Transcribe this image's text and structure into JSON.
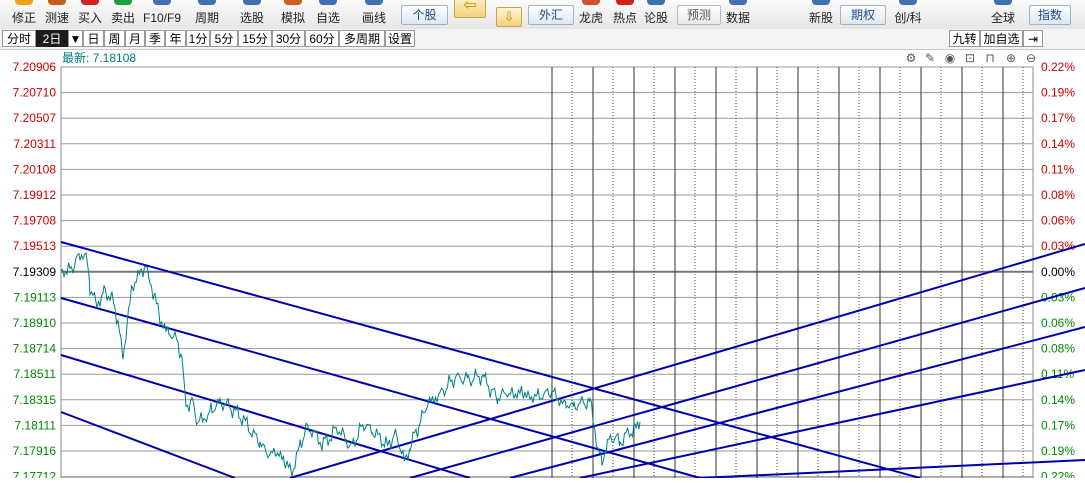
{
  "toolbar": {
    "items": [
      {
        "label": "修正",
        "icon": "edit-icon",
        "color": "#f0a020"
      },
      {
        "label": "测速",
        "icon": "speed-icon",
        "color": "#c06020"
      },
      {
        "label": "买入",
        "icon": "buy-icon",
        "color": "#d02020"
      },
      {
        "label": "卖出",
        "icon": "sell-icon",
        "color": "#20a040"
      },
      {
        "label": "F10/F9",
        "icon": "f10-icon",
        "color": "#4070b0"
      },
      {
        "label": "周期",
        "icon": "period-icon",
        "color": "#4070b0"
      },
      {
        "label": "选股",
        "icon": "stock-picker-icon",
        "color": "#4070b0"
      },
      {
        "label": "模拟",
        "icon": "simulate-icon",
        "color": "#d06020"
      },
      {
        "label": "自选",
        "icon": "watchlist-icon",
        "color": "#4070b0"
      },
      {
        "label": "画线",
        "icon": "draw-line-icon",
        "color": "#4070b0"
      },
      {
        "label": "龙虎",
        "icon": "dragon-tiger-icon",
        "color": "#d05030"
      },
      {
        "label": "热点",
        "icon": "hot-icon",
        "color": "#d02020"
      },
      {
        "label": "论股",
        "icon": "forum-icon",
        "color": "#4070b0"
      },
      {
        "label": "数据",
        "icon": "data-icon",
        "color": "#4070b0"
      },
      {
        "label": "新股",
        "icon": "new-stock-icon",
        "color": "#4070b0"
      },
      {
        "label": "创/科",
        "icon": "star-market-icon",
        "color": "#4070b0"
      },
      {
        "label": "全球",
        "icon": "globe-icon",
        "color": "#4070b0"
      }
    ],
    "btn_gegu": "个股",
    "btn_waihui": "外汇",
    "btn_yuce": "预测",
    "btn_qiquan": "期权",
    "btn_zhishu": "指数",
    "arrow_left": "⇦",
    "arrow_down": "⇩"
  },
  "tabs": {
    "items": [
      "分时",
      "2日",
      "▼",
      "日",
      "周",
      "月",
      "季",
      "年",
      "1分",
      "5分",
      "15分",
      "30分",
      "60分",
      "多周期",
      "设置"
    ],
    "active_index": 1,
    "right": [
      "九转",
      "加自选",
      "⇥"
    ]
  },
  "chart": {
    "latest_label": "最新: 7.18108",
    "y_labels_left": [
      "7.20906",
      "7.20710",
      "7.20507",
      "7.20311",
      "7.20108",
      "7.19912",
      "7.19708",
      "7.19513",
      "7.19309",
      "7.19113",
      "7.18910",
      "7.18714",
      "7.18511",
      "7.18315",
      "7.18111",
      "7.17916",
      "7.17712"
    ],
    "y_labels_right": [
      "0.22%",
      "0.19%",
      "0.17%",
      "0.14%",
      "0.11%",
      "0.08%",
      "0.06%",
      "0.03%",
      "0.00%",
      "0.03%",
      "0.06%",
      "0.08%",
      "0.11%",
      "0.14%",
      "0.17%",
      "0.19%",
      "0.22%"
    ],
    "base_index": 8,
    "colors": {
      "up": "#d00000",
      "down": "#008800",
      "neutral": "#000000",
      "price": "#008080",
      "channel": "#0000aa"
    },
    "tool_icons": [
      "gear-icon",
      "pencil-icon",
      "eye-icon",
      "lock-icon",
      "lock-open-icon",
      "zoom-in-icon",
      "zoom-out-icon"
    ]
  }
}
